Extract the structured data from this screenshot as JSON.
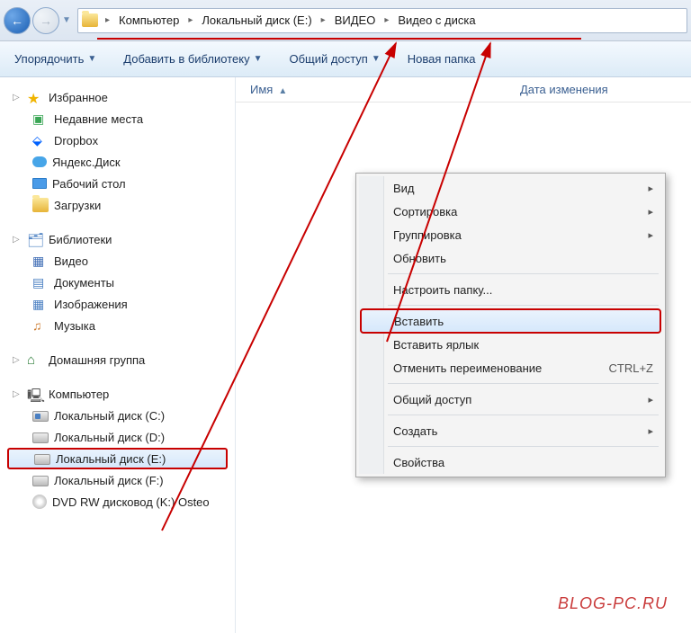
{
  "nav": {
    "back_glyph": "←",
    "fwd_glyph": "→",
    "drop_glyph": "▼"
  },
  "breadcrumb": {
    "sep": "▸",
    "items": [
      "Компьютер",
      "Локальный диск (E:)",
      "ВИДЕО",
      "Видео с диска"
    ]
  },
  "toolbar": {
    "organize": "Упорядочить",
    "addlib": "Добавить в библиотеку",
    "share": "Общий доступ",
    "newfolder": "Новая папка",
    "drop": "▼"
  },
  "columns": {
    "name": "Имя",
    "date": "Дата изменения",
    "sort": "▲"
  },
  "sidebar": {
    "favorites": "Избранное",
    "fav_items": [
      "Недавние места",
      "Dropbox",
      "Яндекс.Диск",
      "Рабочий стол",
      "Загрузки"
    ],
    "libraries": "Библиотеки",
    "lib_items": [
      "Видео",
      "Документы",
      "Изображения",
      "Музыка"
    ],
    "homegroup": "Домашняя группа",
    "computer": "Компьютер",
    "drives": [
      "Локальный диск (C:)",
      "Локальный диск (D:)",
      "Локальный диск (E:)",
      "Локальный диск (F:)",
      "DVD RW дисковод (K:) Osteo"
    ]
  },
  "context": {
    "view": "Вид",
    "sort": "Сортировка",
    "group": "Группировка",
    "refresh": "Обновить",
    "customize": "Настроить папку...",
    "paste": "Вставить",
    "paste_shortcut": "Вставить ярлык",
    "undo_rename": "Отменить переименование",
    "undo_accel": "CTRL+Z",
    "share": "Общий доступ",
    "new": "Создать",
    "props": "Свойства",
    "arrow": "▸"
  },
  "watermark": "BLOG-PC.RU"
}
